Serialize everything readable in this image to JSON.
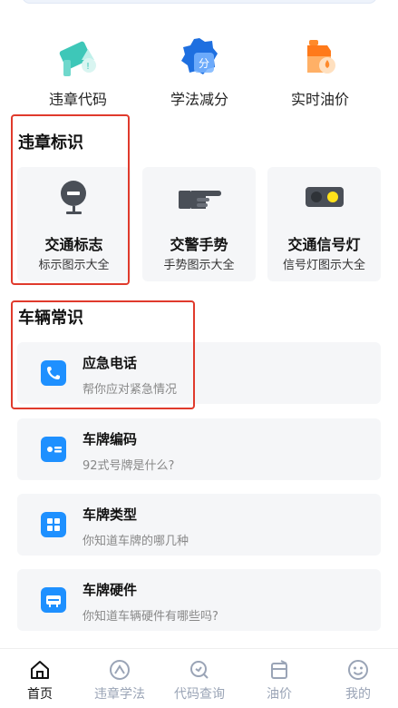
{
  "tools": [
    {
      "label": "违章代码",
      "icon": "violation-code-icon"
    },
    {
      "label": "学法减分",
      "icon": "study-deduct-icon"
    },
    {
      "label": "实时油价",
      "icon": "oil-price-icon"
    }
  ],
  "signs": {
    "title": "违章标识",
    "cards": [
      {
        "title": "交通标志",
        "subtitle": "标示图示大全",
        "icon": "traffic-sign-icon"
      },
      {
        "title": "交警手势",
        "subtitle": "手势图示大全",
        "icon": "police-gesture-icon"
      },
      {
        "title": "交通信号灯",
        "subtitle": "信号灯图示大全",
        "icon": "traffic-light-icon"
      }
    ]
  },
  "vehicle": {
    "title": "车辆常识",
    "items": [
      {
        "title": "应急电话",
        "subtitle": "帮你应对紧急情况",
        "icon": "phone-icon"
      },
      {
        "title": "车牌编码",
        "subtitle": "92式号牌是什么?",
        "icon": "plate-code-icon"
      },
      {
        "title": "车牌类型",
        "subtitle": "你知道车牌的哪几种",
        "icon": "plate-type-icon"
      },
      {
        "title": "车牌硬件",
        "subtitle": "你知道车辆硬件有哪些吗?",
        "icon": "plate-hardware-icon"
      }
    ]
  },
  "nav": [
    {
      "label": "首页",
      "icon": "home-icon",
      "active": true
    },
    {
      "label": "违章学法",
      "icon": "study-icon",
      "active": false
    },
    {
      "label": "代码查询",
      "icon": "code-search-icon",
      "active": false
    },
    {
      "label": "油价",
      "icon": "oil-icon",
      "active": false
    },
    {
      "label": "我的",
      "icon": "profile-icon",
      "active": false
    }
  ],
  "colors": {
    "accent": "#1e90ff",
    "highlight": "#e03a2c",
    "nav_inactive": "#9aa4b6"
  }
}
